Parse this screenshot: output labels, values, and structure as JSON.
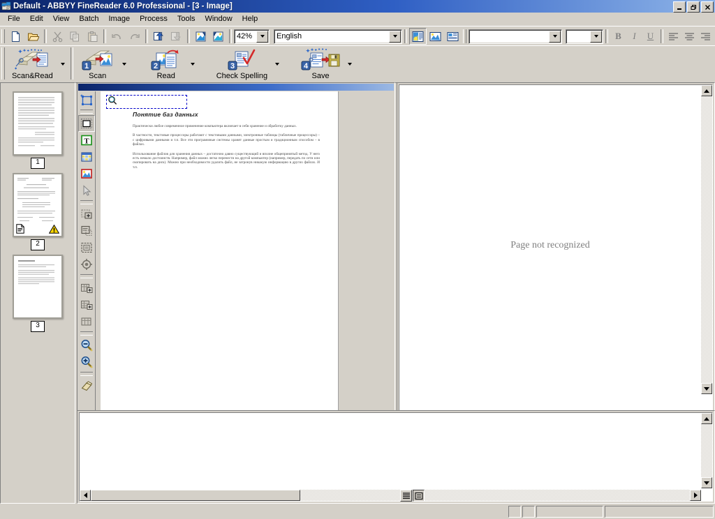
{
  "window": {
    "title": "Default - ABBYY FineReader 6.0 Professional  - [3 - Image]",
    "icon": "finereader-app-icon",
    "minimize": "_",
    "restore": "❐",
    "close": "✕"
  },
  "menubar": {
    "items": [
      {
        "label": "File"
      },
      {
        "label": "Edit"
      },
      {
        "label": "View"
      },
      {
        "label": "Batch"
      },
      {
        "label": "Image"
      },
      {
        "label": "Process"
      },
      {
        "label": "Tools"
      },
      {
        "label": "Window"
      },
      {
        "label": "Help"
      }
    ]
  },
  "standard_toolbar": {
    "buttons": [
      {
        "name": "new-batch-icon",
        "title": "New Batch",
        "enabled": true
      },
      {
        "name": "open-batch-icon",
        "title": "Open Batch",
        "enabled": true
      },
      {
        "name": "cut-icon",
        "title": "Cut",
        "enabled": false
      },
      {
        "name": "copy-icon",
        "title": "Copy",
        "enabled": false
      },
      {
        "name": "paste-icon",
        "title": "Paste",
        "enabled": false
      },
      {
        "name": "undo-icon",
        "title": "Undo",
        "enabled": false
      },
      {
        "name": "redo-icon",
        "title": "Redo",
        "enabled": false
      },
      {
        "name": "open-image-icon",
        "title": "Open Image",
        "enabled": true
      },
      {
        "name": "save-image-icon",
        "title": "Save Image",
        "enabled": false
      },
      {
        "name": "rotate-clockwise-icon",
        "title": "Rotate Clockwise",
        "enabled": true
      },
      {
        "name": "rotate-counterclockwise-icon",
        "title": "Rotate Counterclockwise",
        "enabled": true
      }
    ],
    "zoom": {
      "value": "42%",
      "label": "Zoom"
    },
    "language": {
      "value": "English",
      "label": "Recognition language"
    },
    "view_buttons": [
      {
        "name": "view-image-and-text-icon",
        "title": "Image and Text window",
        "selected": true
      },
      {
        "name": "view-image-icon",
        "title": "Image window",
        "selected": false
      },
      {
        "name": "view-text-icon",
        "title": "Text window",
        "selected": false
      }
    ]
  },
  "format_toolbar": {
    "font_family": {
      "value": "",
      "placeholder": ""
    },
    "font_size": {
      "value": "",
      "placeholder": ""
    },
    "bold": "B",
    "italic": "I",
    "underline": "U",
    "align_left": "align-left",
    "align_center": "align-center",
    "align_right": "align-right",
    "align_justify": "align-justify",
    "paragraph_marks": "¶"
  },
  "main_toolbar": {
    "buttons": [
      {
        "name": "scan-and-read-button",
        "label": "Scan&Read",
        "icon": "wand-scanner-page-icon",
        "step": null,
        "has_dropdown": true
      },
      {
        "name": "scan-button",
        "label": "Scan",
        "icon": "scanner-icon",
        "step": "1",
        "has_dropdown": true
      },
      {
        "name": "read-button",
        "label": "Read",
        "icon": "page-arrow-icon",
        "step": "2",
        "has_dropdown": true
      },
      {
        "name": "check-spelling-button",
        "label": "Check Spelling",
        "icon": "page-check-icon",
        "step": "3",
        "has_dropdown": true
      },
      {
        "name": "save-button",
        "label": "Save",
        "icon": "page-to-disk-icon",
        "step": "4",
        "has_dropdown": true
      }
    ]
  },
  "thumbnails": {
    "pages": [
      {
        "number": "1",
        "name": "page-thumbnail-1",
        "selected": false,
        "has_text_badge": false,
        "has_warning_badge": false,
        "style": "dense-text"
      },
      {
        "number": "2",
        "name": "page-thumbnail-2",
        "selected": false,
        "has_text_badge": true,
        "has_warning_badge": true,
        "style": "form"
      },
      {
        "number": "3",
        "name": "page-thumbnail-3",
        "selected": true,
        "has_text_badge": false,
        "has_warning_badge": false,
        "style": "short-text"
      }
    ]
  },
  "image_tools": {
    "buttons": [
      {
        "name": "analyze-layout-tool",
        "title": "Analyze Layout",
        "group": 0
      },
      {
        "name": "draw-block-tool",
        "title": "Draw Block",
        "group": 1,
        "selected": true
      },
      {
        "name": "draw-text-block-tool",
        "title": "Draw Text Block",
        "group": 1
      },
      {
        "name": "draw-table-block-tool",
        "title": "Draw Table Block",
        "group": 1
      },
      {
        "name": "draw-picture-block-tool",
        "title": "Draw Picture Block",
        "group": 1
      },
      {
        "name": "select-block-tool",
        "title": "Select Block",
        "group": 1
      },
      {
        "name": "add-block-part-tool",
        "title": "Add Block Part",
        "group": 2
      },
      {
        "name": "cut-block-part-tool",
        "title": "Cut Block Part",
        "group": 2
      },
      {
        "name": "reorder-blocks-tool",
        "title": "Reorder Blocks",
        "group": 2
      },
      {
        "name": "block-properties-tool",
        "title": "Block Properties",
        "group": 2
      },
      {
        "name": "add-table-row-tool",
        "title": "Add Horizontal Separator",
        "group": 3
      },
      {
        "name": "add-table-column-tool",
        "title": "Add Vertical Separator",
        "group": 3
      },
      {
        "name": "delete-separators-tool",
        "title": "Delete All Separators",
        "group": 3
      },
      {
        "name": "zoom-out-tool",
        "title": "Zoom Out",
        "group": 4
      },
      {
        "name": "zoom-in-tool",
        "title": "Zoom In",
        "group": 4
      },
      {
        "name": "eraser-tool",
        "title": "Eraser",
        "group": 5
      }
    ]
  },
  "image_window": {
    "title_caption": "3 - Image",
    "selection_block": {
      "name": "selected-block",
      "label": ""
    },
    "document": {
      "heading": "Понятие баз данных",
      "paragraphs": [
        "Практически любое современное применение компьютера включает в себя хранение и обработку данных.",
        "В частности, текстовые процессоры работают с текстовыми данными, электронные таблицы (табличные процессоры) – с цифровыми данными и т.п. Все эти программные системы хранят данные простым и традиционным способом – в файлах.",
        "Использование файлов для хранения данных – достаточно давно существующий и вполне общепринятый метод. У него есть немало достоинств. Например, файл можно легко перенести на другой компьютер (например, передать по сети или скопировать на диск). Можно при необходимости удалить файл, не затронув никакую информацию в других файлах. И т.п."
      ]
    }
  },
  "text_window": {
    "message": "Page not recognized",
    "view_buttons": [
      {
        "name": "text-view-plain-icon",
        "title": "Plain text view",
        "selected": false
      },
      {
        "name": "text-view-formatted-icon",
        "title": "Formatted view",
        "selected": true
      }
    ]
  },
  "status_bar": {
    "panels": [
      "",
      "",
      "",
      ""
    ]
  },
  "colors": {
    "face": "#d4d0c8",
    "title_start": "#0a246a",
    "title_end": "#8eb4e8",
    "shadow": "#808080",
    "highlight": "#ffffff",
    "selection_border": "#0000c8",
    "warning": "#ffd800",
    "text_gray": "#808080"
  }
}
